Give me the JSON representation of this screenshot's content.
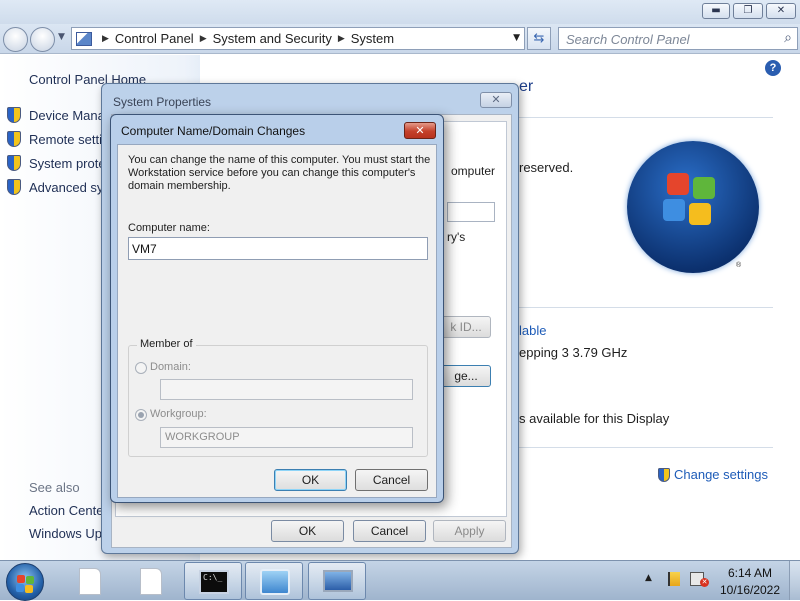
{
  "window_controls": {
    "minimize": "▬",
    "maximize": "❐",
    "close": "✕"
  },
  "address_bar": {
    "crumbs": [
      "Control Panel",
      "System and Security",
      "System"
    ],
    "separator": "▶",
    "dropdown_glyph": "▼"
  },
  "search": {
    "placeholder": "Search Control Panel",
    "icon": "search-icon"
  },
  "left_pane": {
    "home_link": "Control Panel Home",
    "tasks": [
      {
        "label": "Device Manag",
        "icon": "shield-icon"
      },
      {
        "label": "Remote settir",
        "icon": "shield-icon"
      },
      {
        "label": "System prote",
        "icon": "shield-icon"
      },
      {
        "label": "Advanced sys",
        "icon": "shield-icon"
      }
    ],
    "see_also_heading": "See also",
    "see_also": [
      "Action Cente",
      "Windows Upc"
    ]
  },
  "main_pane": {
    "heading_fragment": "er",
    "rights_fragment": "reserved.",
    "rating_fragment": "lable",
    "processor_fragment": "epping 3   3.79 GHz",
    "touch_fragment": "s available for this Display",
    "change_settings": "Change settings"
  },
  "system_properties": {
    "title": "System Properties",
    "close_glyph": "✕",
    "fragments": {
      "computer": "omputer",
      "rys": "ry's",
      "id_button": "k ID...",
      "change_button": "ge..."
    },
    "buttons": {
      "ok": "OK",
      "cancel": "Cancel",
      "apply": "Apply"
    }
  },
  "name_change_dialog": {
    "title": "Computer Name/Domain Changes",
    "close_glyph": "✕",
    "intro": "You can change the name of this computer.  You must start the Workstation service before you can change this computer's domain membership.",
    "computer_name_label": "Computer name:",
    "computer_name_value": "VM7",
    "member_of_legend": "Member of",
    "domain_label": "Domain:",
    "domain_value": "",
    "workgroup_label": "Workgroup:",
    "workgroup_value": "WORKGROUP",
    "selected_membership": "workgroup",
    "buttons": {
      "ok": "OK",
      "cancel": "Cancel"
    }
  },
  "taskbar": {
    "cmd_glyph": "C:\\_",
    "tray_arrow": "▲",
    "time": "6:14 AM",
    "date": "10/16/2022"
  }
}
